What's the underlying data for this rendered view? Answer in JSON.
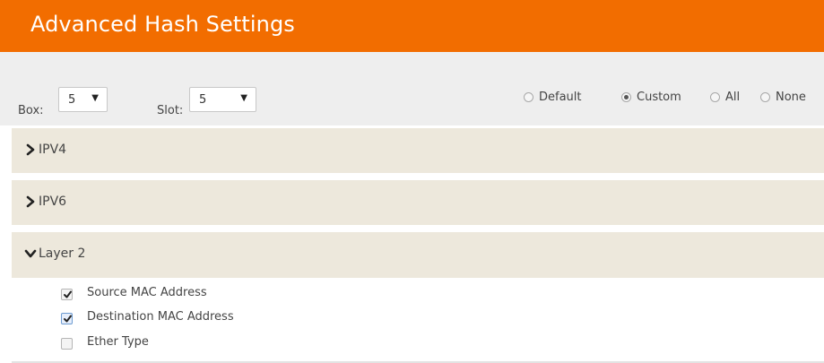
{
  "header": {
    "title": "Advanced Hash Settings",
    "bg_color": "#f26d00"
  },
  "toolbar": {
    "box": {
      "label": "Box:",
      "value": "5"
    },
    "slot": {
      "label": "Slot:",
      "value": "5"
    },
    "mode": {
      "options": [
        {
          "label": "Default",
          "checked": false
        },
        {
          "label": "Custom",
          "checked": true
        },
        {
          "label": "All",
          "checked": false
        },
        {
          "label": "None",
          "checked": false
        }
      ]
    }
  },
  "sections": [
    {
      "label": "IPV4",
      "expanded": false
    },
    {
      "label": "IPV6",
      "expanded": false
    },
    {
      "label": "Layer 2",
      "expanded": true,
      "options": [
        {
          "label": "Source MAC Address",
          "checked": true
        },
        {
          "label": "Destination MAC Address",
          "checked": true
        },
        {
          "label": "Ether Type",
          "checked": false
        }
      ]
    }
  ],
  "section_bg_color": "#ede8dc"
}
